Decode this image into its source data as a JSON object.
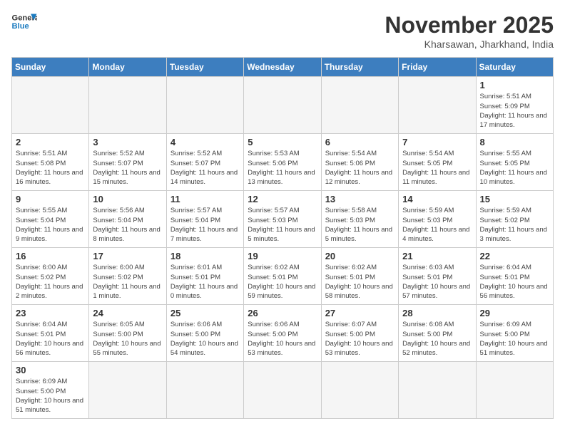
{
  "logo": {
    "text_general": "General",
    "text_blue": "Blue"
  },
  "title": "November 2025",
  "subtitle": "Kharsawan, Jharkhand, India",
  "weekdays": [
    "Sunday",
    "Monday",
    "Tuesday",
    "Wednesday",
    "Thursday",
    "Friday",
    "Saturday"
  ],
  "weeks": [
    [
      {
        "day": "",
        "info": ""
      },
      {
        "day": "",
        "info": ""
      },
      {
        "day": "",
        "info": ""
      },
      {
        "day": "",
        "info": ""
      },
      {
        "day": "",
        "info": ""
      },
      {
        "day": "",
        "info": ""
      },
      {
        "day": "1",
        "info": "Sunrise: 5:51 AM\nSunset: 5:09 PM\nDaylight: 11 hours and 17 minutes."
      }
    ],
    [
      {
        "day": "2",
        "info": "Sunrise: 5:51 AM\nSunset: 5:08 PM\nDaylight: 11 hours and 16 minutes."
      },
      {
        "day": "3",
        "info": "Sunrise: 5:52 AM\nSunset: 5:07 PM\nDaylight: 11 hours and 15 minutes."
      },
      {
        "day": "4",
        "info": "Sunrise: 5:52 AM\nSunset: 5:07 PM\nDaylight: 11 hours and 14 minutes."
      },
      {
        "day": "5",
        "info": "Sunrise: 5:53 AM\nSunset: 5:06 PM\nDaylight: 11 hours and 13 minutes."
      },
      {
        "day": "6",
        "info": "Sunrise: 5:54 AM\nSunset: 5:06 PM\nDaylight: 11 hours and 12 minutes."
      },
      {
        "day": "7",
        "info": "Sunrise: 5:54 AM\nSunset: 5:05 PM\nDaylight: 11 hours and 11 minutes."
      },
      {
        "day": "8",
        "info": "Sunrise: 5:55 AM\nSunset: 5:05 PM\nDaylight: 11 hours and 10 minutes."
      }
    ],
    [
      {
        "day": "9",
        "info": "Sunrise: 5:55 AM\nSunset: 5:04 PM\nDaylight: 11 hours and 9 minutes."
      },
      {
        "day": "10",
        "info": "Sunrise: 5:56 AM\nSunset: 5:04 PM\nDaylight: 11 hours and 8 minutes."
      },
      {
        "day": "11",
        "info": "Sunrise: 5:57 AM\nSunset: 5:04 PM\nDaylight: 11 hours and 7 minutes."
      },
      {
        "day": "12",
        "info": "Sunrise: 5:57 AM\nSunset: 5:03 PM\nDaylight: 11 hours and 5 minutes."
      },
      {
        "day": "13",
        "info": "Sunrise: 5:58 AM\nSunset: 5:03 PM\nDaylight: 11 hours and 5 minutes."
      },
      {
        "day": "14",
        "info": "Sunrise: 5:59 AM\nSunset: 5:03 PM\nDaylight: 11 hours and 4 minutes."
      },
      {
        "day": "15",
        "info": "Sunrise: 5:59 AM\nSunset: 5:02 PM\nDaylight: 11 hours and 3 minutes."
      }
    ],
    [
      {
        "day": "16",
        "info": "Sunrise: 6:00 AM\nSunset: 5:02 PM\nDaylight: 11 hours and 2 minutes."
      },
      {
        "day": "17",
        "info": "Sunrise: 6:00 AM\nSunset: 5:02 PM\nDaylight: 11 hours and 1 minute."
      },
      {
        "day": "18",
        "info": "Sunrise: 6:01 AM\nSunset: 5:01 PM\nDaylight: 11 hours and 0 minutes."
      },
      {
        "day": "19",
        "info": "Sunrise: 6:02 AM\nSunset: 5:01 PM\nDaylight: 10 hours and 59 minutes."
      },
      {
        "day": "20",
        "info": "Sunrise: 6:02 AM\nSunset: 5:01 PM\nDaylight: 10 hours and 58 minutes."
      },
      {
        "day": "21",
        "info": "Sunrise: 6:03 AM\nSunset: 5:01 PM\nDaylight: 10 hours and 57 minutes."
      },
      {
        "day": "22",
        "info": "Sunrise: 6:04 AM\nSunset: 5:01 PM\nDaylight: 10 hours and 56 minutes."
      }
    ],
    [
      {
        "day": "23",
        "info": "Sunrise: 6:04 AM\nSunset: 5:01 PM\nDaylight: 10 hours and 56 minutes."
      },
      {
        "day": "24",
        "info": "Sunrise: 6:05 AM\nSunset: 5:00 PM\nDaylight: 10 hours and 55 minutes."
      },
      {
        "day": "25",
        "info": "Sunrise: 6:06 AM\nSunset: 5:00 PM\nDaylight: 10 hours and 54 minutes."
      },
      {
        "day": "26",
        "info": "Sunrise: 6:06 AM\nSunset: 5:00 PM\nDaylight: 10 hours and 53 minutes."
      },
      {
        "day": "27",
        "info": "Sunrise: 6:07 AM\nSunset: 5:00 PM\nDaylight: 10 hours and 53 minutes."
      },
      {
        "day": "28",
        "info": "Sunrise: 6:08 AM\nSunset: 5:00 PM\nDaylight: 10 hours and 52 minutes."
      },
      {
        "day": "29",
        "info": "Sunrise: 6:09 AM\nSunset: 5:00 PM\nDaylight: 10 hours and 51 minutes."
      }
    ],
    [
      {
        "day": "30",
        "info": "Sunrise: 6:09 AM\nSunset: 5:00 PM\nDaylight: 10 hours and 51 minutes."
      },
      {
        "day": "",
        "info": ""
      },
      {
        "day": "",
        "info": ""
      },
      {
        "day": "",
        "info": ""
      },
      {
        "day": "",
        "info": ""
      },
      {
        "day": "",
        "info": ""
      },
      {
        "day": "",
        "info": ""
      }
    ]
  ]
}
